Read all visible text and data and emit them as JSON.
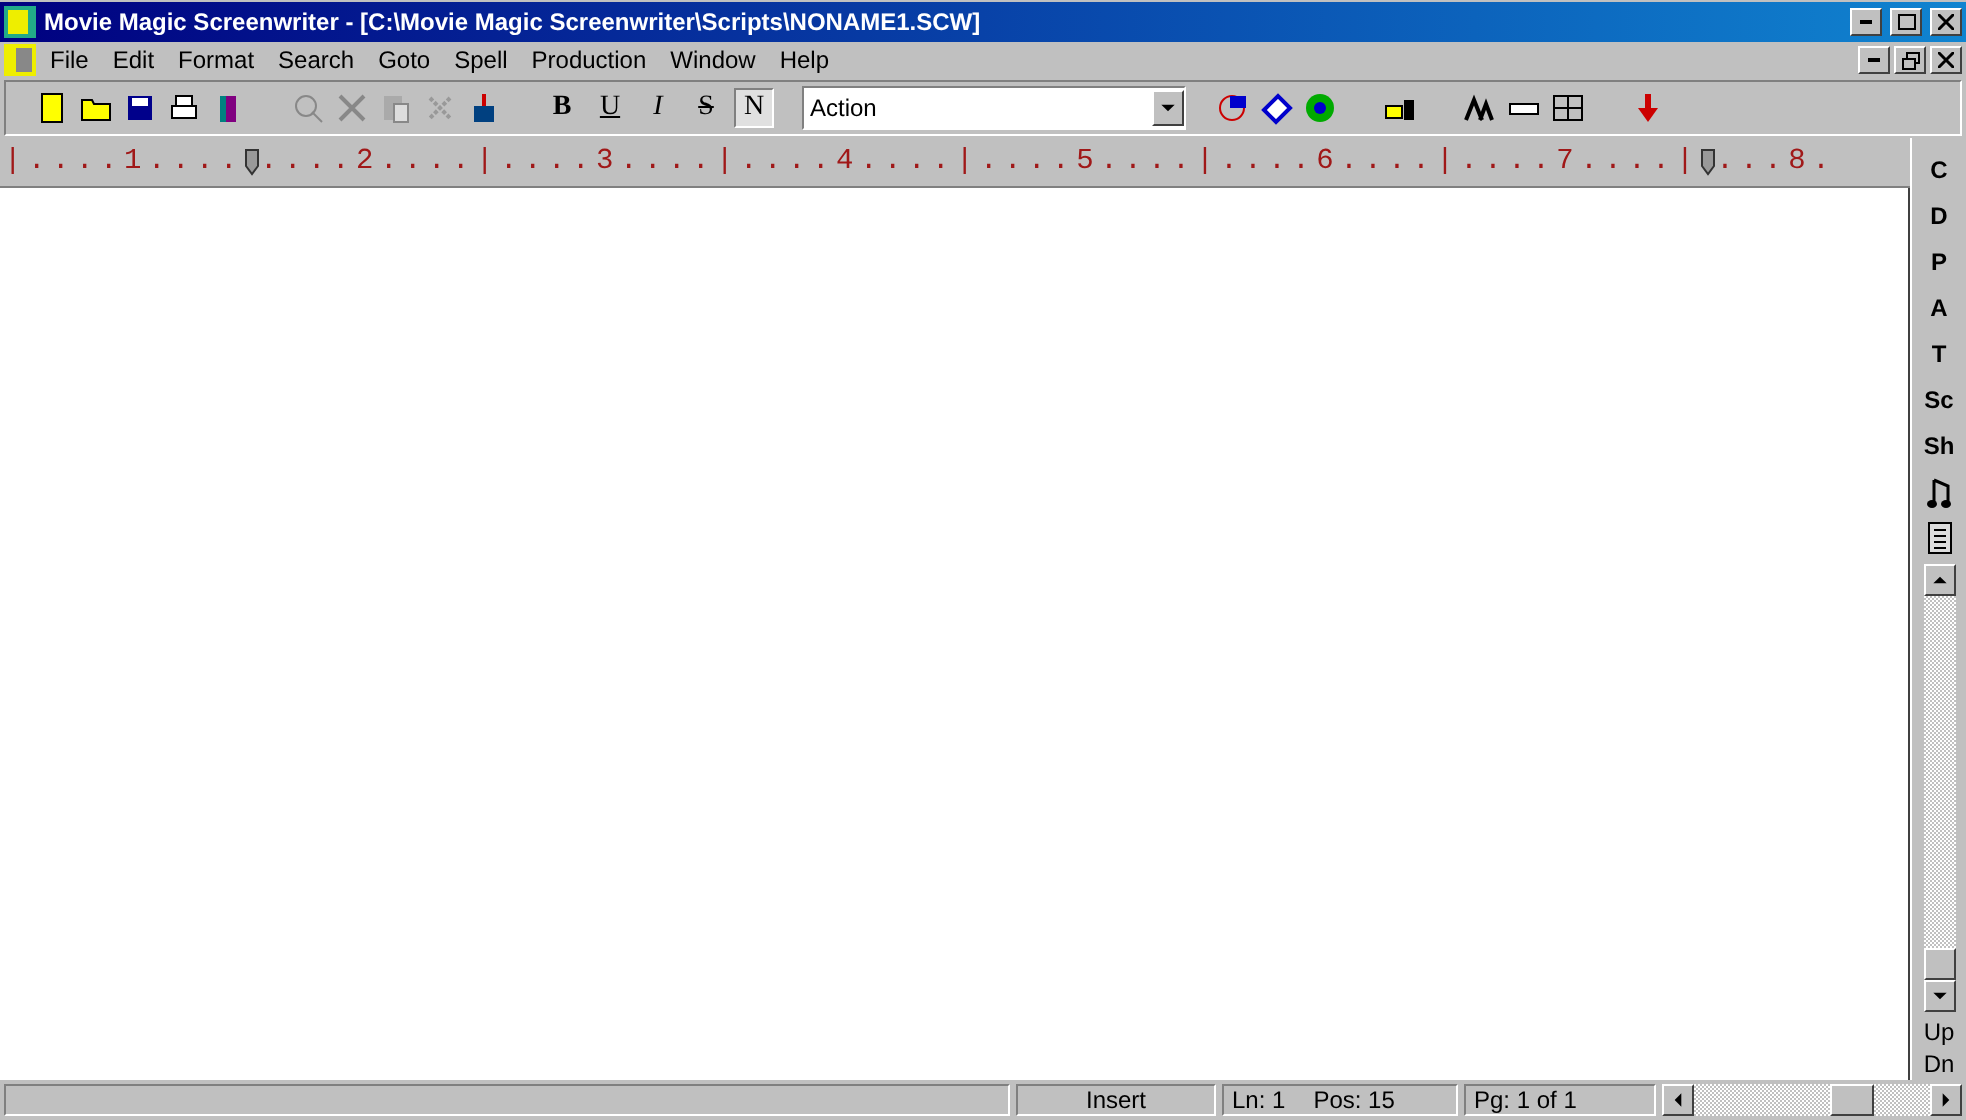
{
  "window": {
    "title": "Movie Magic Screenwriter - [C:\\Movie Magic Screenwriter\\Scripts\\NONAME1.SCW]"
  },
  "menu": [
    "File",
    "Edit",
    "Format",
    "Search",
    "Goto",
    "Spell",
    "Production",
    "Window",
    "Help"
  ],
  "toolbar": {
    "format_buttons": [
      {
        "label": "B",
        "selected": false
      },
      {
        "label": "U",
        "selected": false
      },
      {
        "label": "I",
        "selected": false
      },
      {
        "label": "S",
        "selected": false
      },
      {
        "label": "N",
        "selected": true
      }
    ],
    "element_select": {
      "value": "Action"
    }
  },
  "ruler": {
    "segments": [
      "|....1....",
      "....2....|....3....|....4....|....5....|....6....|....7....|",
      "...8."
    ]
  },
  "side_buttons": [
    {
      "kind": "text",
      "label": "C"
    },
    {
      "kind": "text",
      "label": "D"
    },
    {
      "kind": "text",
      "label": "P"
    },
    {
      "kind": "text",
      "label": "A"
    },
    {
      "kind": "text",
      "label": "T"
    },
    {
      "kind": "text",
      "label": "Sc"
    },
    {
      "kind": "text",
      "label": "Sh"
    },
    {
      "kind": "music"
    },
    {
      "kind": "list"
    }
  ],
  "side_paging": [
    "Up",
    "Dn"
  ],
  "status_bar": {
    "mode": "Insert",
    "line": "Ln: 1",
    "position": "Pos: 15",
    "page": "Pg: 1 of 1"
  }
}
